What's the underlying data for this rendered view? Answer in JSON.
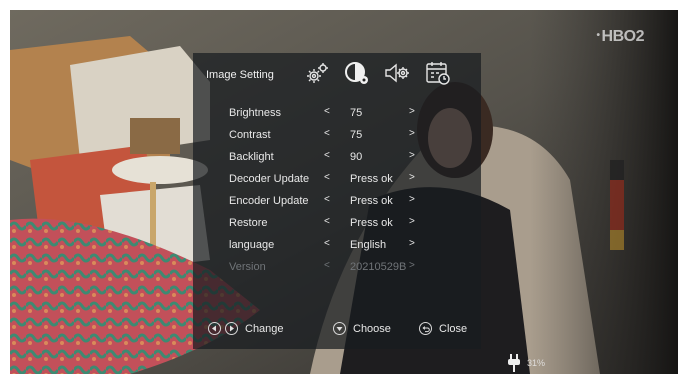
{
  "overlay": {
    "channel_logo": "HBO2",
    "power_pct": "31%"
  },
  "menu": {
    "title": "Image Setting",
    "tabs": [
      {
        "icon": "gears-icon"
      },
      {
        "icon": "contrast-icon"
      },
      {
        "icon": "speaker-gear-icon"
      },
      {
        "icon": "calendar-clock-icon"
      }
    ],
    "rows": [
      {
        "label": "Brightness",
        "value": "75"
      },
      {
        "label": "Contrast",
        "value": "75"
      },
      {
        "label": "Backlight",
        "value": "90"
      },
      {
        "label": "Decoder Update",
        "value": "Press ok"
      },
      {
        "label": "Encoder Update",
        "value": "Press ok"
      },
      {
        "label": "Restore",
        "value": "Press ok"
      },
      {
        "label": "language",
        "value": "English"
      },
      {
        "label": "Version",
        "value": "20210529B"
      }
    ],
    "arrow_left": "<",
    "arrow_right": ">",
    "footer": {
      "change": "Change",
      "choose": "Choose",
      "close": "Close"
    }
  }
}
